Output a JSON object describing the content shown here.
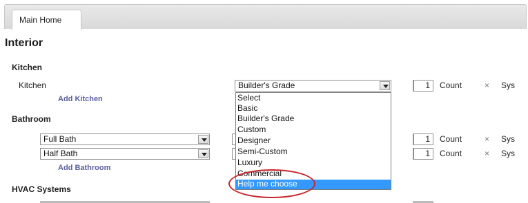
{
  "tabs": [
    {
      "label": "Main Home"
    }
  ],
  "section": {
    "title": "Interior"
  },
  "kitchen": {
    "group_label": "Kitchen",
    "item_label": "Kitchen",
    "grade_value": "Builder's Grade",
    "count": "1",
    "count_label": "Count",
    "remove_glyph": "×",
    "sys_label": "Sys",
    "add_link": "Add Kitchen"
  },
  "bathroom": {
    "group_label": "Bathroom",
    "rows": [
      {
        "type_value": "Full Bath",
        "count": "1",
        "count_label": "Count",
        "remove_glyph": "×",
        "sys_label": "Sys"
      },
      {
        "type_value": "Half Bath",
        "count": "1",
        "count_label": "Count",
        "remove_glyph": "×",
        "sys_label": "Sys"
      }
    ],
    "add_link": "Add Bathroom"
  },
  "hvac": {
    "group_label": "HVAC Systems"
  },
  "grade_dropdown": {
    "options": [
      "Select",
      "Basic",
      "Builder's Grade",
      "Custom",
      "Designer",
      "Semi-Custom",
      "Luxury",
      "Commercial",
      "Help me choose"
    ],
    "highlighted": "Help me choose"
  },
  "colors": {
    "highlight": "#3399ff",
    "link": "#5a5f9e",
    "annotation": "#c8242b"
  },
  "icons": {
    "dropdown_arrow": "chevron-down-icon",
    "remove": "close-icon"
  }
}
